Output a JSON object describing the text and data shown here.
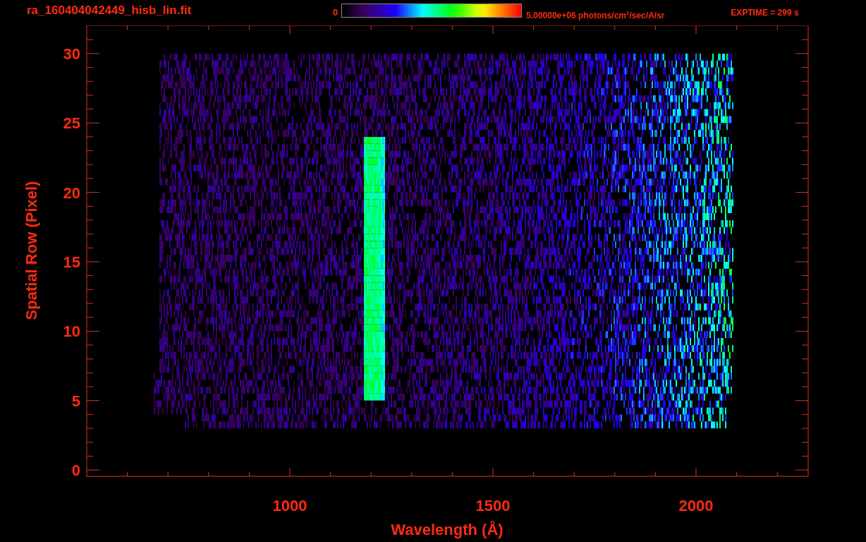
{
  "header": {
    "file_name": "ra_160404042449_hisb_lin.fit",
    "colorbar": {
      "min_label": "0",
      "max_label": "5.00000e+06 photons/cm$^{2}$/sec/A/sr"
    },
    "exposure": "EXPTIME = 299 s"
  },
  "plot": {
    "x_axis": {
      "title": "Wavelength (Å)",
      "tick_labels": [
        "1000",
        "1500",
        "2000"
      ]
    },
    "y_axis": {
      "title": "Spatial Row (Pixel)",
      "tick_labels": [
        "30",
        "25",
        "20",
        "15",
        "10",
        "5",
        "0"
      ]
    }
  }
}
